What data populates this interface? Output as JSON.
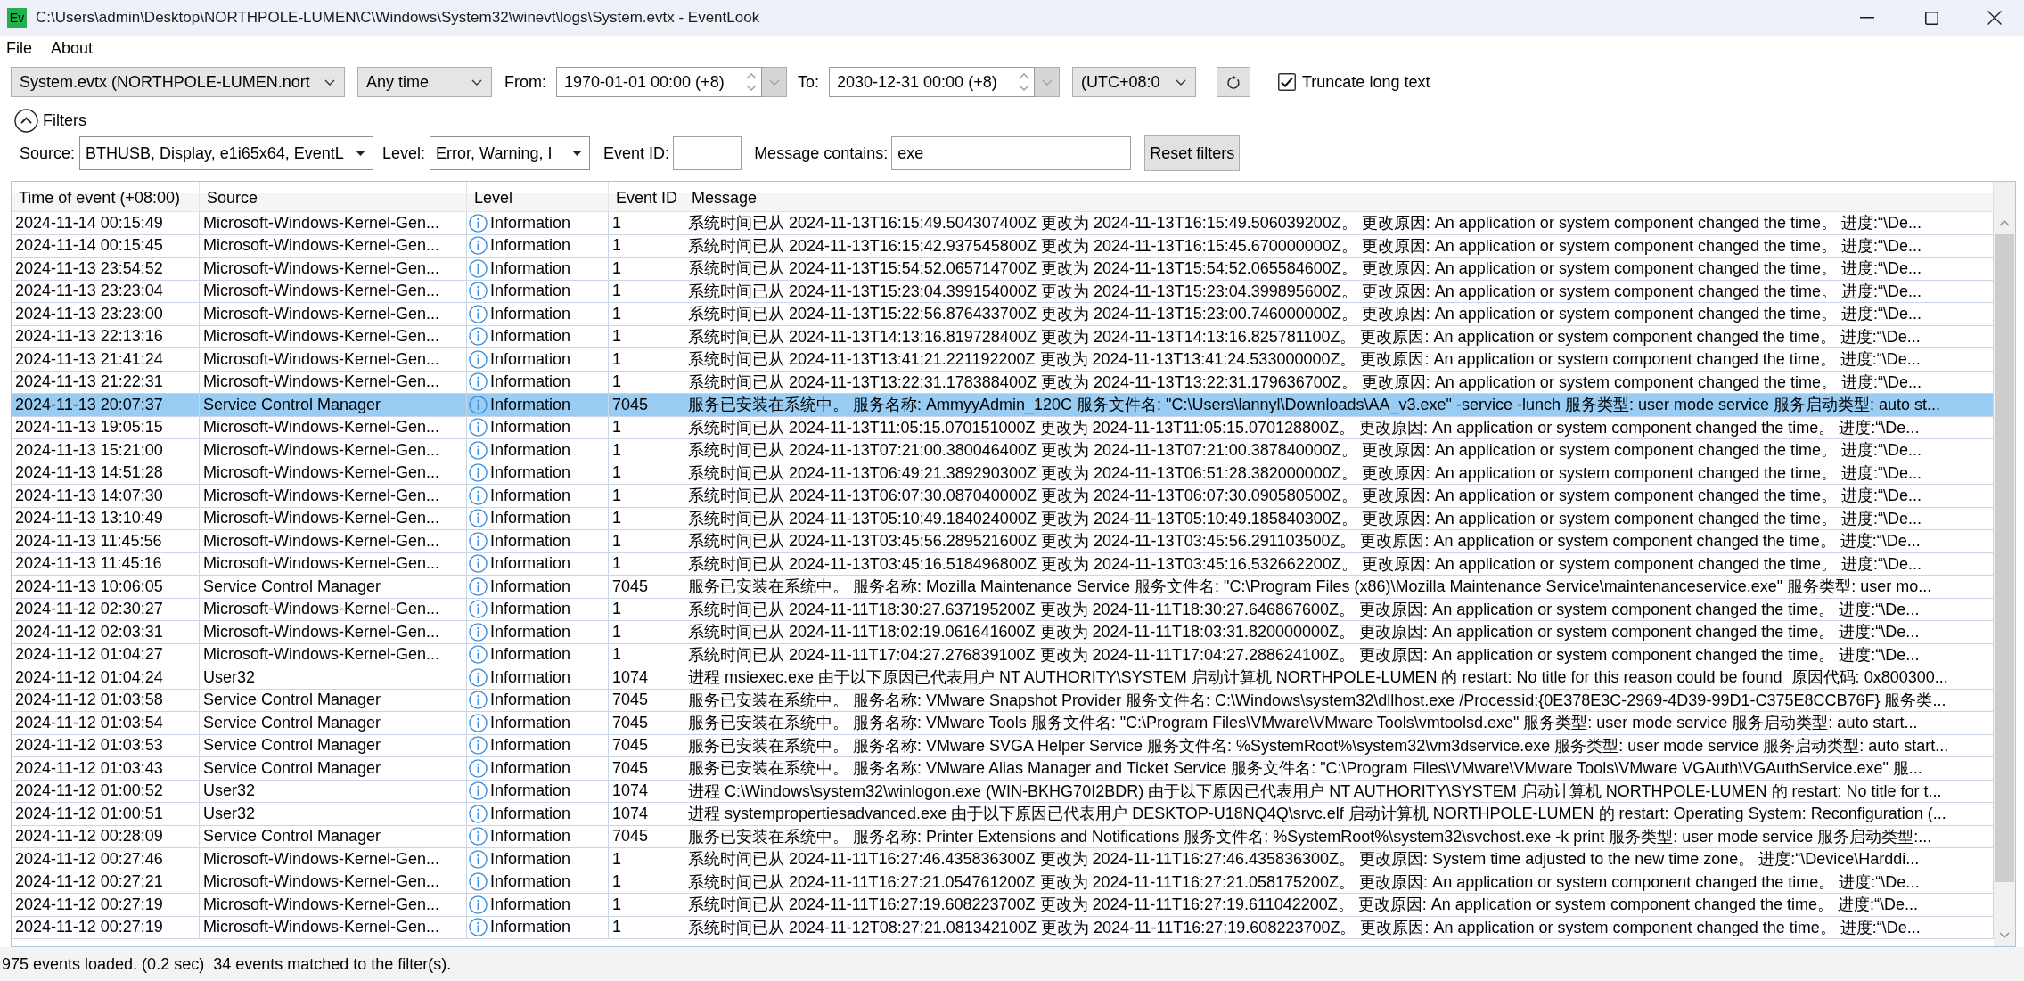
{
  "window": {
    "logo": "Ev",
    "title": "C:\\Users\\admin\\Desktop\\NORTHPOLE-LUMEN\\C\\Windows\\System32\\winevt\\logs\\System.evtx - EventLook"
  },
  "menu": [
    {
      "label": "File"
    },
    {
      "label": "About"
    }
  ],
  "toolbar": {
    "log_file": {
      "value": "System.evtx (NORTHPOLE-LUMEN.nort"
    },
    "time_range": {
      "value": "Any time"
    },
    "from": {
      "label": "From:",
      "value": "1970-01-01 00:00 (+8)"
    },
    "to": {
      "label": "To:",
      "value": "2030-12-31 00:00 (+8)"
    },
    "timezone": {
      "value": "(UTC+08:0"
    },
    "truncate": {
      "label": "Truncate long text",
      "checked": true
    }
  },
  "filters": {
    "label": "Filters",
    "expanded": true,
    "source": {
      "label": "Source:",
      "value": "BTHUSB, Display, e1i65x64, EventL"
    },
    "level": {
      "label": "Level:",
      "value": "Error, Warning, I"
    },
    "event_id": {
      "label": "Event ID:"
    },
    "message": {
      "label": "Message contains:",
      "value": "exe"
    },
    "reset_button": "Reset filters"
  },
  "table": {
    "columns": [
      "Time of event (+08:00)",
      "Source",
      "Level",
      "Event ID",
      "Message"
    ],
    "rows": [
      {
        "time": "2024-11-14 00:15:49",
        "source": "Microsoft-Windows-Kernel-Gen...",
        "kind": "information",
        "level": "Information",
        "event_id": "1",
        "message": "系统时间已从 2024-11-13T16:15:49.504307400Z 更改为 2024-11-13T16:15:49.506039200Z。 更改原因: An application or system component changed the time。 进度:“\\De...",
        "selected": false
      },
      {
        "time": "2024-11-14 00:15:45",
        "source": "Microsoft-Windows-Kernel-Gen...",
        "kind": "information",
        "level": "Information",
        "event_id": "1",
        "message": "系统时间已从 2024-11-13T16:15:42.937545800Z 更改为 2024-11-13T16:15:45.670000000Z。 更改原因: An application or system component changed the time。 进度:“\\De...",
        "selected": false
      },
      {
        "time": "2024-11-13 23:54:52",
        "source": "Microsoft-Windows-Kernel-Gen...",
        "kind": "information",
        "level": "Information",
        "event_id": "1",
        "message": "系统时间已从 2024-11-13T15:54:52.065714700Z 更改为 2024-11-13T15:54:52.065584600Z。 更改原因: An application or system component changed the time。 进度:“\\De...",
        "selected": false
      },
      {
        "time": "2024-11-13 23:23:04",
        "source": "Microsoft-Windows-Kernel-Gen...",
        "kind": "information",
        "level": "Information",
        "event_id": "1",
        "message": "系统时间已从 2024-11-13T15:23:04.399154000Z 更改为 2024-11-13T15:23:04.399895600Z。 更改原因: An application or system component changed the time。 进度:“\\De...",
        "selected": false
      },
      {
        "time": "2024-11-13 23:23:00",
        "source": "Microsoft-Windows-Kernel-Gen...",
        "kind": "information",
        "level": "Information",
        "event_id": "1",
        "message": "系统时间已从 2024-11-13T15:22:56.876433700Z 更改为 2024-11-13T15:23:00.746000000Z。 更改原因: An application or system component changed the time。 进度:“\\De...",
        "selected": false
      },
      {
        "time": "2024-11-13 22:13:16",
        "source": "Microsoft-Windows-Kernel-Gen...",
        "kind": "information",
        "level": "Information",
        "event_id": "1",
        "message": "系统时间已从 2024-11-13T14:13:16.819728400Z 更改为 2024-11-13T14:13:16.825781100Z。 更改原因: An application or system component changed the time。 进度:“\\De...",
        "selected": false
      },
      {
        "time": "2024-11-13 21:41:24",
        "source": "Microsoft-Windows-Kernel-Gen...",
        "kind": "information",
        "level": "Information",
        "event_id": "1",
        "message": "系统时间已从 2024-11-13T13:41:21.221192200Z 更改为 2024-11-13T13:41:24.533000000Z。 更改原因: An application or system component changed the time。 进度:“\\De...",
        "selected": false
      },
      {
        "time": "2024-11-13 21:22:31",
        "source": "Microsoft-Windows-Kernel-Gen...",
        "kind": "information",
        "level": "Information",
        "event_id": "1",
        "message": "系统时间已从 2024-11-13T13:22:31.178388400Z 更改为 2024-11-13T13:22:31.179636700Z。 更改原因: An application or system component changed the time。 进度:“\\De...",
        "selected": false
      },
      {
        "time": "2024-11-13 20:07:37",
        "source": "Service Control Manager",
        "kind": "information",
        "level": "Information",
        "event_id": "7045",
        "message": "服务已安装在系统中。 服务名称: AmmyyAdmin_120C 服务文件名: \"C:\\Users\\lannyl\\Downloads\\AA_v3.exe\" -service -lunch 服务类型: user mode service 服务启动类型: auto st...",
        "selected": true
      },
      {
        "time": "2024-11-13 19:05:15",
        "source": "Microsoft-Windows-Kernel-Gen...",
        "kind": "information",
        "level": "Information",
        "event_id": "1",
        "message": "系统时间已从 2024-11-13T11:05:15.070151000Z 更改为 2024-11-13T11:05:15.070128800Z。 更改原因: An application or system component changed the time。 进度:“\\De...",
        "selected": false
      },
      {
        "time": "2024-11-13 15:21:00",
        "source": "Microsoft-Windows-Kernel-Gen...",
        "kind": "information",
        "level": "Information",
        "event_id": "1",
        "message": "系统时间已从 2024-11-13T07:21:00.380046400Z 更改为 2024-11-13T07:21:00.387840000Z。 更改原因: An application or system component changed the time。 进度:“\\De...",
        "selected": false
      },
      {
        "time": "2024-11-13 14:51:28",
        "source": "Microsoft-Windows-Kernel-Gen...",
        "kind": "information",
        "level": "Information",
        "event_id": "1",
        "message": "系统时间已从 2024-11-13T06:49:21.389290300Z 更改为 2024-11-13T06:51:28.382000000Z。 更改原因: An application or system component changed the time。 进度:“\\De...",
        "selected": false
      },
      {
        "time": "2024-11-13 14:07:30",
        "source": "Microsoft-Windows-Kernel-Gen...",
        "kind": "information",
        "level": "Information",
        "event_id": "1",
        "message": "系统时间已从 2024-11-13T06:07:30.087040000Z 更改为 2024-11-13T06:07:30.090580500Z。 更改原因: An application or system component changed the time。 进度:“\\De...",
        "selected": false
      },
      {
        "time": "2024-11-13 13:10:49",
        "source": "Microsoft-Windows-Kernel-Gen...",
        "kind": "information",
        "level": "Information",
        "event_id": "1",
        "message": "系统时间已从 2024-11-13T05:10:49.184024000Z 更改为 2024-11-13T05:10:49.185840300Z。 更改原因: An application or system component changed the time。 进度:“\\De...",
        "selected": false
      },
      {
        "time": "2024-11-13 11:45:56",
        "source": "Microsoft-Windows-Kernel-Gen...",
        "kind": "information",
        "level": "Information",
        "event_id": "1",
        "message": "系统时间已从 2024-11-13T03:45:56.289521600Z 更改为 2024-11-13T03:45:56.291103500Z。 更改原因: An application or system component changed the time。 进度:“\\De...",
        "selected": false
      },
      {
        "time": "2024-11-13 11:45:16",
        "source": "Microsoft-Windows-Kernel-Gen...",
        "kind": "information",
        "level": "Information",
        "event_id": "1",
        "message": "系统时间已从 2024-11-13T03:45:16.518496800Z 更改为 2024-11-13T03:45:16.532662200Z。 更改原因: An application or system component changed the time。 进度:“\\De...",
        "selected": false
      },
      {
        "time": "2024-11-13 10:06:05",
        "source": "Service Control Manager",
        "kind": "information",
        "level": "Information",
        "event_id": "7045",
        "message": "服务已安装在系统中。 服务名称: Mozilla Maintenance Service 服务文件名: \"C:\\Program Files (x86)\\Mozilla Maintenance Service\\maintenanceservice.exe\" 服务类型: user mo...",
        "selected": false
      },
      {
        "time": "2024-11-12 02:30:27",
        "source": "Microsoft-Windows-Kernel-Gen...",
        "kind": "information",
        "level": "Information",
        "event_id": "1",
        "message": "系统时间已从 2024-11-11T18:30:27.637195200Z 更改为 2024-11-11T18:30:27.646867600Z。 更改原因: An application or system component changed the time。 进度:“\\De...",
        "selected": false
      },
      {
        "time": "2024-11-12 02:03:31",
        "source": "Microsoft-Windows-Kernel-Gen...",
        "kind": "information",
        "level": "Information",
        "event_id": "1",
        "message": "系统时间已从 2024-11-11T18:02:19.061641600Z 更改为 2024-11-11T18:03:31.820000000Z。 更改原因: An application or system component changed the time。 进度:“\\De...",
        "selected": false
      },
      {
        "time": "2024-11-12 01:04:27",
        "source": "Microsoft-Windows-Kernel-Gen...",
        "kind": "information",
        "level": "Information",
        "event_id": "1",
        "message": "系统时间已从 2024-11-11T17:04:27.276839100Z 更改为 2024-11-11T17:04:27.288624100Z。 更改原因: An application or system component changed the time。 进度:“\\De...",
        "selected": false
      },
      {
        "time": "2024-11-12 01:04:24",
        "source": "User32",
        "kind": "information",
        "level": "Information",
        "event_id": "1074",
        "message": "进程 msiexec.exe 由于以下原因已代表用户 NT AUTHORITY\\SYSTEM 启动计算机 NORTHPOLE-LUMEN 的 restart: No title for this reason could be found  原因代码: 0x800300...",
        "selected": false
      },
      {
        "time": "2024-11-12 01:03:58",
        "source": "Service Control Manager",
        "kind": "information",
        "level": "Information",
        "event_id": "7045",
        "message": "服务已安装在系统中。 服务名称: VMware Snapshot Provider 服务文件名: C:\\Windows\\system32\\dllhost.exe /Processid:{0E378E3C-2969-4D39-99D1-C375E8CCB76F} 服务类...",
        "selected": false
      },
      {
        "time": "2024-11-12 01:03:54",
        "source": "Service Control Manager",
        "kind": "information",
        "level": "Information",
        "event_id": "7045",
        "message": "服务已安装在系统中。 服务名称: VMware Tools 服务文件名: \"C:\\Program Files\\VMware\\VMware Tools\\vmtoolsd.exe\" 服务类型: user mode service 服务启动类型: auto start...",
        "selected": false
      },
      {
        "time": "2024-11-12 01:03:53",
        "source": "Service Control Manager",
        "kind": "information",
        "level": "Information",
        "event_id": "7045",
        "message": "服务已安装在系统中。 服务名称: VMware SVGA Helper Service 服务文件名: %SystemRoot%\\system32\\vm3dservice.exe 服务类型: user mode service 服务启动类型: auto start...",
        "selected": false
      },
      {
        "time": "2024-11-12 01:03:43",
        "source": "Service Control Manager",
        "kind": "information",
        "level": "Information",
        "event_id": "7045",
        "message": "服务已安装在系统中。 服务名称: VMware Alias Manager and Ticket Service 服务文件名: \"C:\\Program Files\\VMware\\VMware Tools\\VMware VGAuth\\VGAuthService.exe\" 服...",
        "selected": false
      },
      {
        "time": "2024-11-12 01:00:52",
        "source": "User32",
        "kind": "information",
        "level": "Information",
        "event_id": "1074",
        "message": "进程 C:\\Windows\\system32\\winlogon.exe (WIN-BKHG70I2BDR) 由于以下原因已代表用户 NT AUTHORITY\\SYSTEM 启动计算机 NORTHPOLE-LUMEN 的 restart: No title for t...",
        "selected": false
      },
      {
        "time": "2024-11-12 01:00:51",
        "source": "User32",
        "kind": "information",
        "level": "Information",
        "event_id": "1074",
        "message": "进程 systempropertiesadvanced.exe 由于以下原因已代表用户 DESKTOP-U18NQ4Q\\srvc.elf 启动计算机 NORTHPOLE-LUMEN 的 restart: Operating System: Reconfiguration (...",
        "selected": false
      },
      {
        "time": "2024-11-12 00:28:09",
        "source": "Service Control Manager",
        "kind": "information",
        "level": "Information",
        "event_id": "7045",
        "message": "服务已安装在系统中。 服务名称: Printer Extensions and Notifications 服务文件名: %SystemRoot%\\system32\\svchost.exe -k print 服务类型: user mode service 服务启动类型:...",
        "selected": false
      },
      {
        "time": "2024-11-12 00:27:46",
        "source": "Microsoft-Windows-Kernel-Gen...",
        "kind": "information",
        "level": "Information",
        "event_id": "1",
        "message": "系统时间已从 2024-11-11T16:27:46.435836300Z 更改为 2024-11-11T16:27:46.435836300Z。 更改原因: System time adjusted to the new time zone。 进度:“\\Device\\Harddi...",
        "selected": false
      },
      {
        "time": "2024-11-12 00:27:21",
        "source": "Microsoft-Windows-Kernel-Gen...",
        "kind": "information",
        "level": "Information",
        "event_id": "1",
        "message": "系统时间已从 2024-11-11T16:27:21.054761200Z 更改为 2024-11-11T16:27:21.058175200Z。 更改原因: An application or system component changed the time。 进度:“\\De...",
        "selected": false
      },
      {
        "time": "2024-11-12 00:27:19",
        "source": "Microsoft-Windows-Kernel-Gen...",
        "kind": "information",
        "level": "Information",
        "event_id": "1",
        "message": "系统时间已从 2024-11-11T16:27:19.608223700Z 更改为 2024-11-11T16:27:19.611042200Z。 更改原因: An application or system component changed the time。 进度:“\\De...",
        "selected": false
      },
      {
        "time": "2024-11-12 00:27:19",
        "source": "Microsoft-Windows-Kernel-Gen...",
        "kind": "information",
        "level": "Information",
        "event_id": "1",
        "message": "系统时间已从 2024-11-12T08:27:21.081342100Z 更改为 2024-11-11T16:27:19.608223700Z。 更改原因: An application or system component changed the time。 进度:“\\De...",
        "selected": false
      }
    ]
  },
  "status_bar": [
    "975 events loaded. (0.2 sec)",
    "34 events matched to the filter(s)."
  ]
}
